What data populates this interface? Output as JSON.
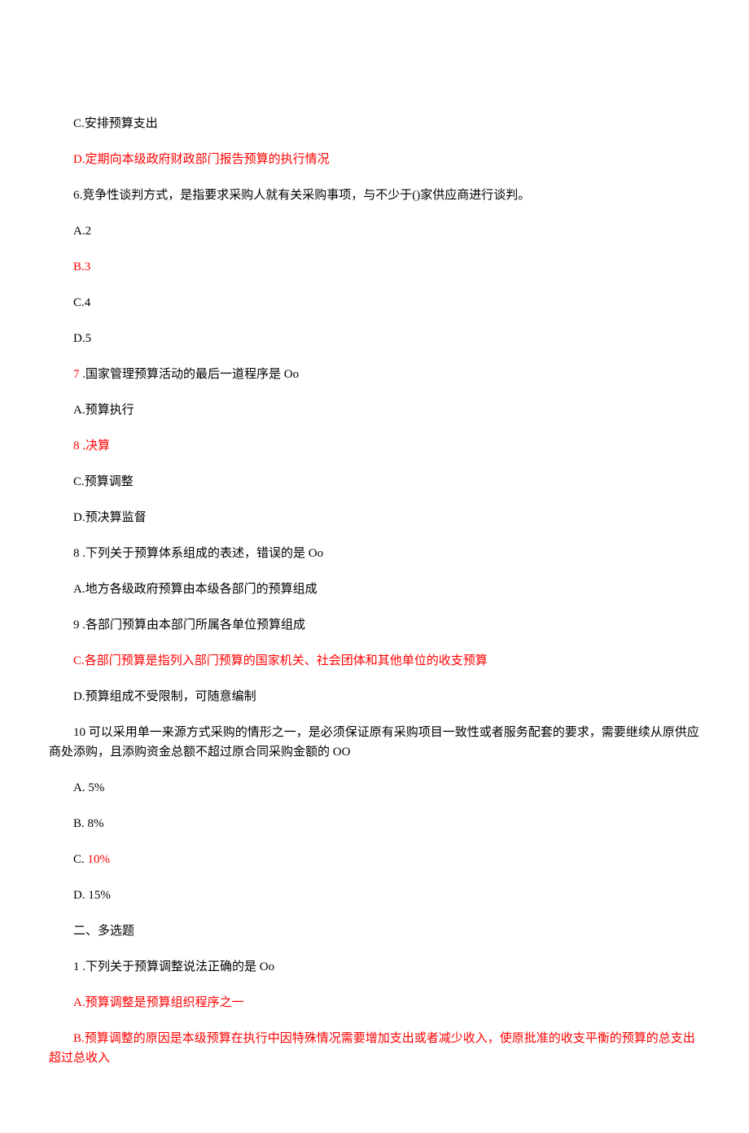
{
  "lines": [
    {
      "text": "C.安排预算支出",
      "red": false
    },
    {
      "text": "D.定期向本级政府财政部门报告预算的执行情况",
      "red": true
    },
    {
      "text": "6.竞争性谈判方式，是指要求采购人就有关采购事项，与不少于()家供应商进行谈判。",
      "red": false
    },
    {
      "text": "A.2",
      "red": false
    },
    {
      "text": "B.3",
      "red": true
    },
    {
      "text": "C.4",
      "red": false
    },
    {
      "text": "D.5",
      "red": false
    },
    {
      "q7_num": "7",
      "q7_text": " .国家管理预算活动的最后一道程序是 Oo",
      "red_num": true
    },
    {
      "text": "A.预算执行",
      "red": false
    },
    {
      "q8_num": "8",
      "q8_text": " .决算",
      "red_num": true,
      "red_text": true
    },
    {
      "text": "C.预算调整",
      "red": false
    },
    {
      "text": "D.预决算监督",
      "red": false
    },
    {
      "text": "8 .下列关于预算体系组成的表述，错误的是 Oo",
      "red": false
    },
    {
      "text": "A.地方各级政府预算由本级各部门的预算组成",
      "red": false
    },
    {
      "text": "9 .各部门预算由本部门所属各单位预算组成",
      "red": false
    },
    {
      "text": "C.各部门预算是指列入部门预算的国家机关、社会团体和其他单位的收支预算",
      "red": true
    },
    {
      "text": "D.预算组成不受限制，可随意编制",
      "red": false
    },
    {
      "q10_stem": "10 可以采用单一来源方式采购的情形之一，是必须保证原有采购项目一致性或者服务配套的要求，需要继续从原供应商处添购，且添购资金总额不超过原合同采购金额的 OO",
      "wrap": true
    },
    {
      "text": "A.  5%",
      "red": false
    },
    {
      "text": "B.  8%",
      "red": false
    },
    {
      "opt_label": "C.  ",
      "opt_value": "10%",
      "red_value": true
    },
    {
      "text": "D.  15%",
      "red": false
    },
    {
      "text": "二、多选题",
      "red": false
    },
    {
      "text": "1 .下列关于预算调整说法正确的是 Oo",
      "red": false
    },
    {
      "text": "A.预算调整是预算组织程序之一",
      "red": true
    },
    {
      "mq1b": "B.预算调整的原因是本级预算在执行中因特殊情况需要增加支出或者减少收入，使原批准的收支平衡的预算的总支出超过总收入",
      "red": true,
      "wrap": true
    }
  ]
}
